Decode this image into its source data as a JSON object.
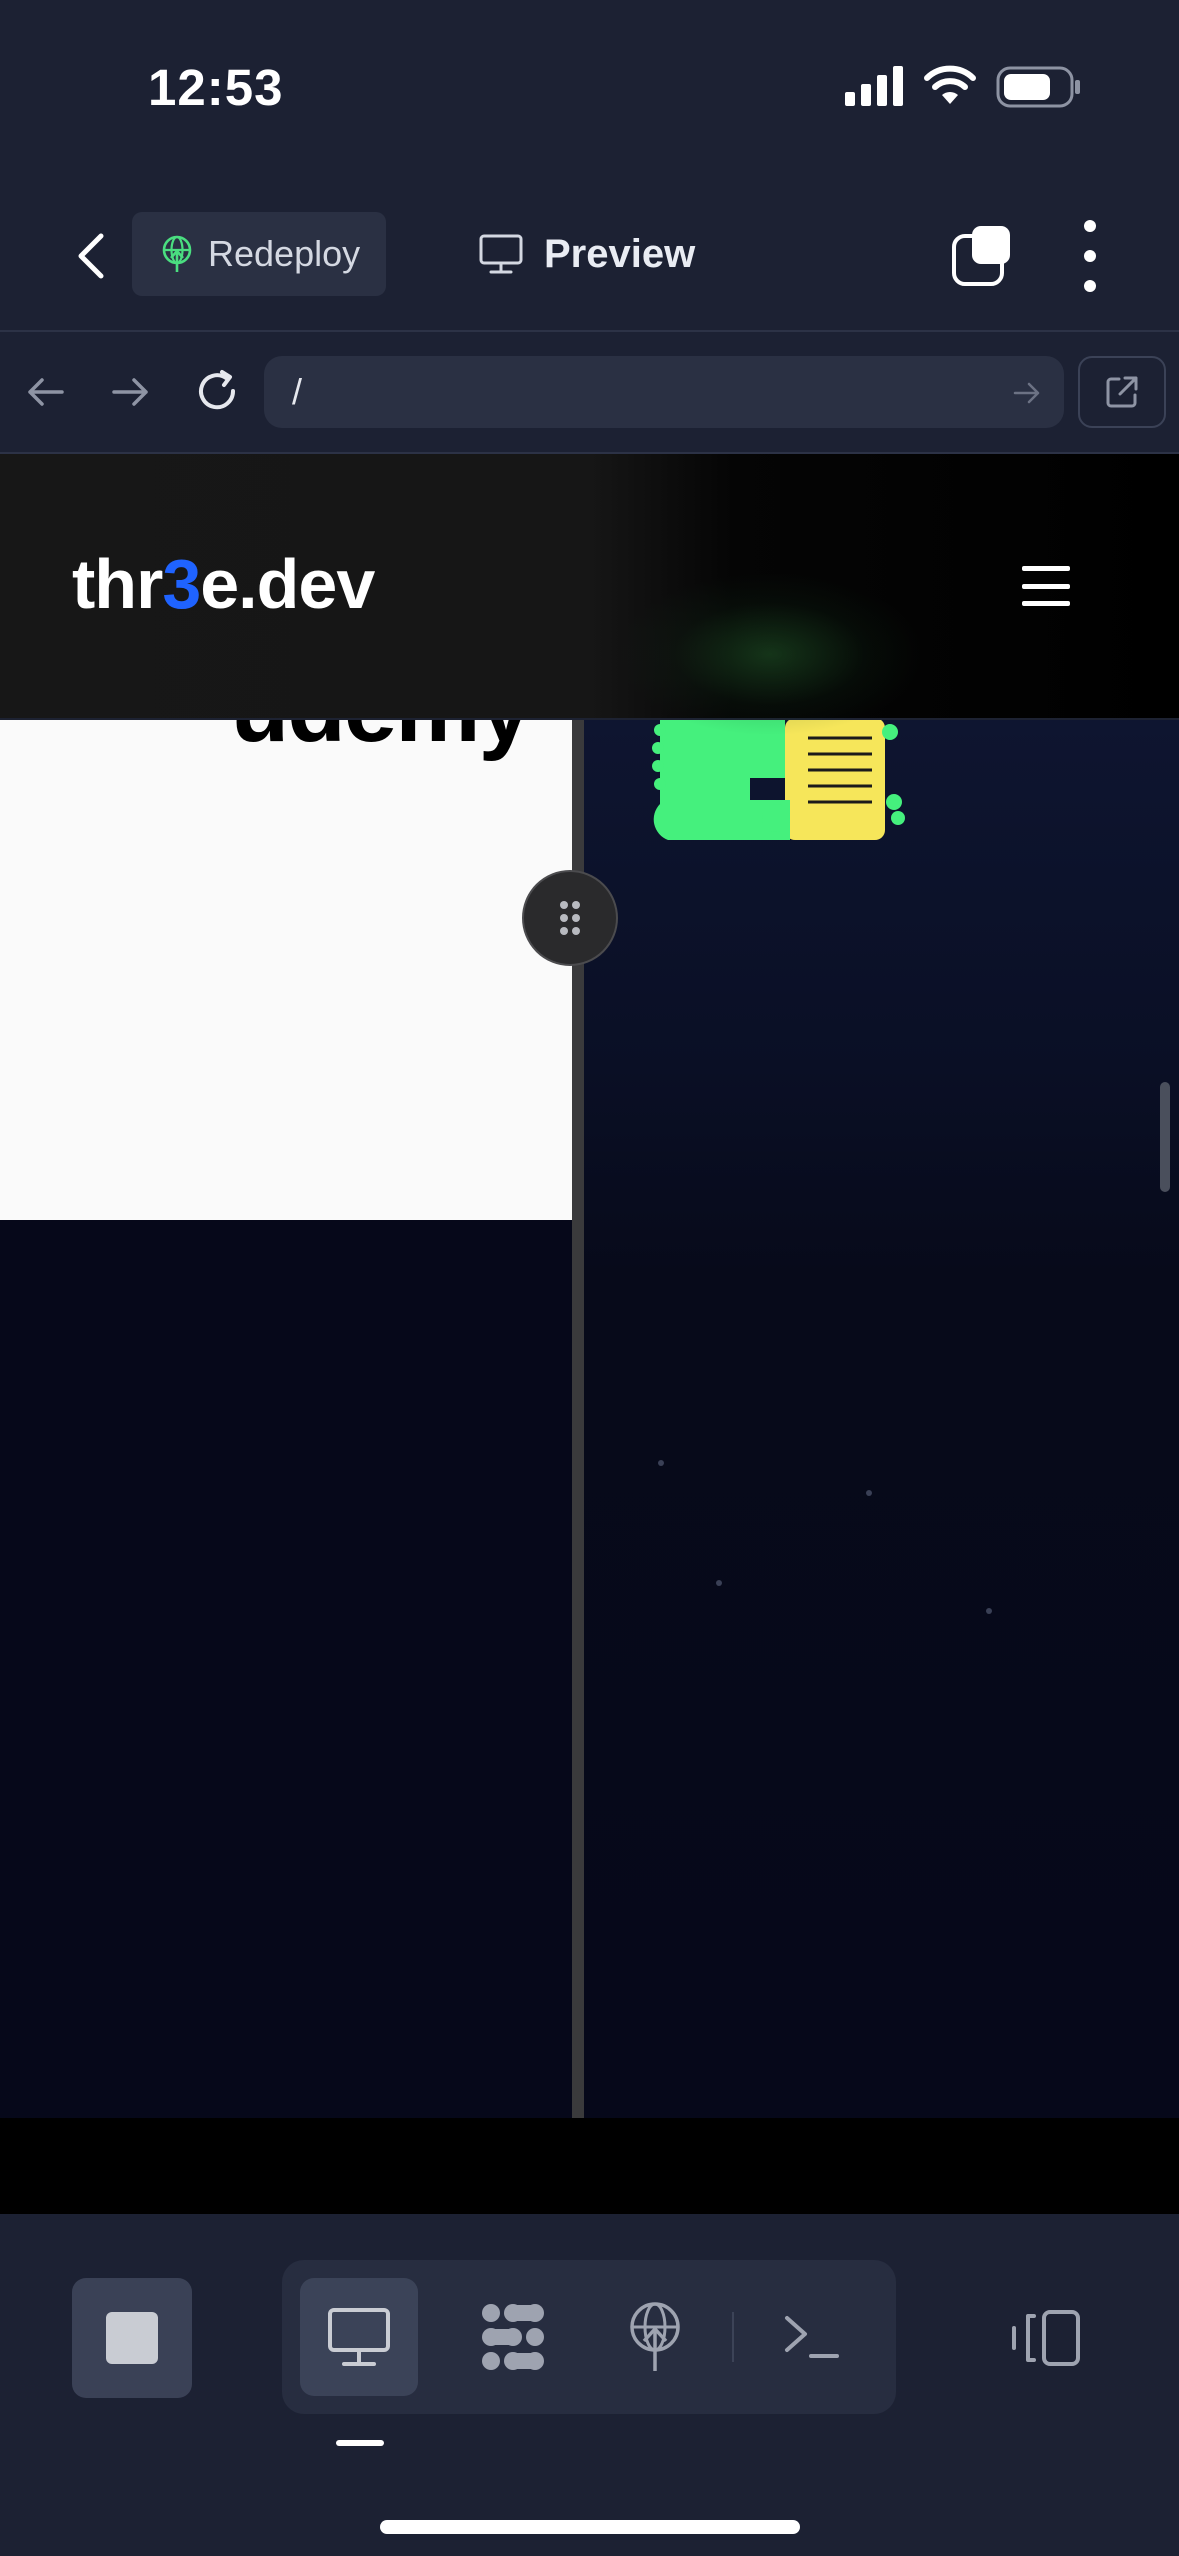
{
  "status_bar": {
    "time": "12:53"
  },
  "header": {
    "redeploy_label": "Redeploy",
    "preview_label": "Preview"
  },
  "browser": {
    "url": "/"
  },
  "site": {
    "logo_prefix": "thr",
    "logo_accent": "3",
    "logo_suffix": "e.dev",
    "accent_color": "#1f63ff",
    "partner_text": "udemy"
  },
  "bottom_bar": {
    "modes": [
      "preview-icon",
      "modules-icon",
      "deploy-icon",
      "terminal-icon"
    ],
    "active_mode": "preview-icon"
  },
  "colors": {
    "app_background": "#1c2133",
    "control_background": "#2a3043",
    "redeploy_icon": "#4ade80"
  }
}
